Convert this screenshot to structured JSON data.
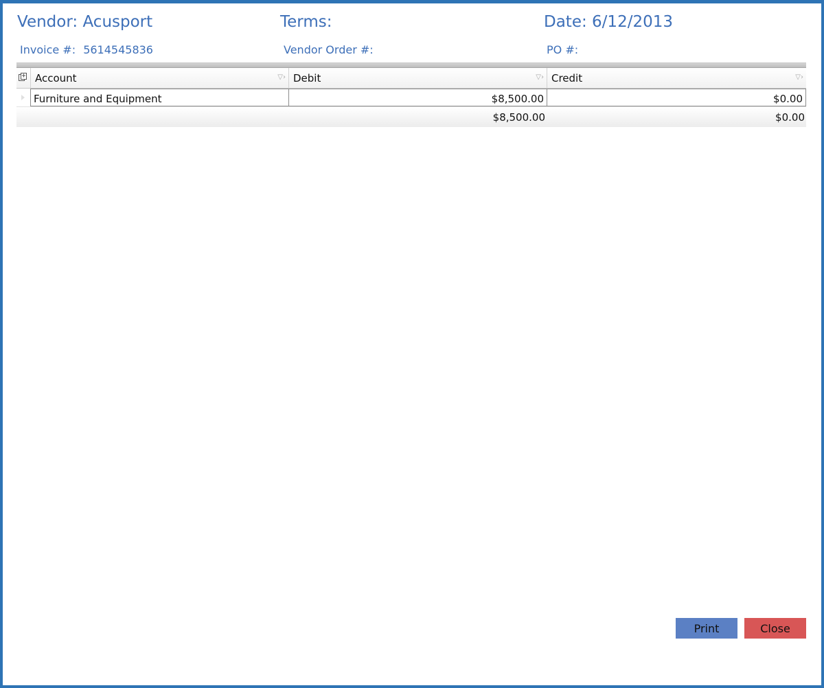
{
  "header": {
    "vendor_label": "Vendor:",
    "vendor_value": "Acusport",
    "terms_label": "Terms:",
    "terms_value": "",
    "date_label": "Date:",
    "date_value": "6/12/2013",
    "invoice_label": "Invoice #:",
    "invoice_value": "5614545836",
    "vendor_order_label": "Vendor Order #:",
    "vendor_order_value": "",
    "po_label": "PO #:",
    "po_value": ""
  },
  "grid": {
    "columns": [
      "Account",
      "Debit",
      "Credit"
    ],
    "rows": [
      {
        "account": "Furniture and Equipment",
        "debit": "$8,500.00",
        "credit": "$0.00"
      }
    ],
    "totals": {
      "debit": "$8,500.00",
      "credit": "$0.00"
    }
  },
  "buttons": {
    "print": "Print",
    "close": "Close"
  },
  "colors": {
    "accent": "#2e74b5",
    "header_text": "#3d6fb8",
    "print_button": "#5b80c4",
    "close_button": "#d85656"
  },
  "icons": {
    "column_chooser": "column-chooser-icon",
    "filter": "filter-icon",
    "row_indicator": "row-indicator-arrow-icon"
  }
}
